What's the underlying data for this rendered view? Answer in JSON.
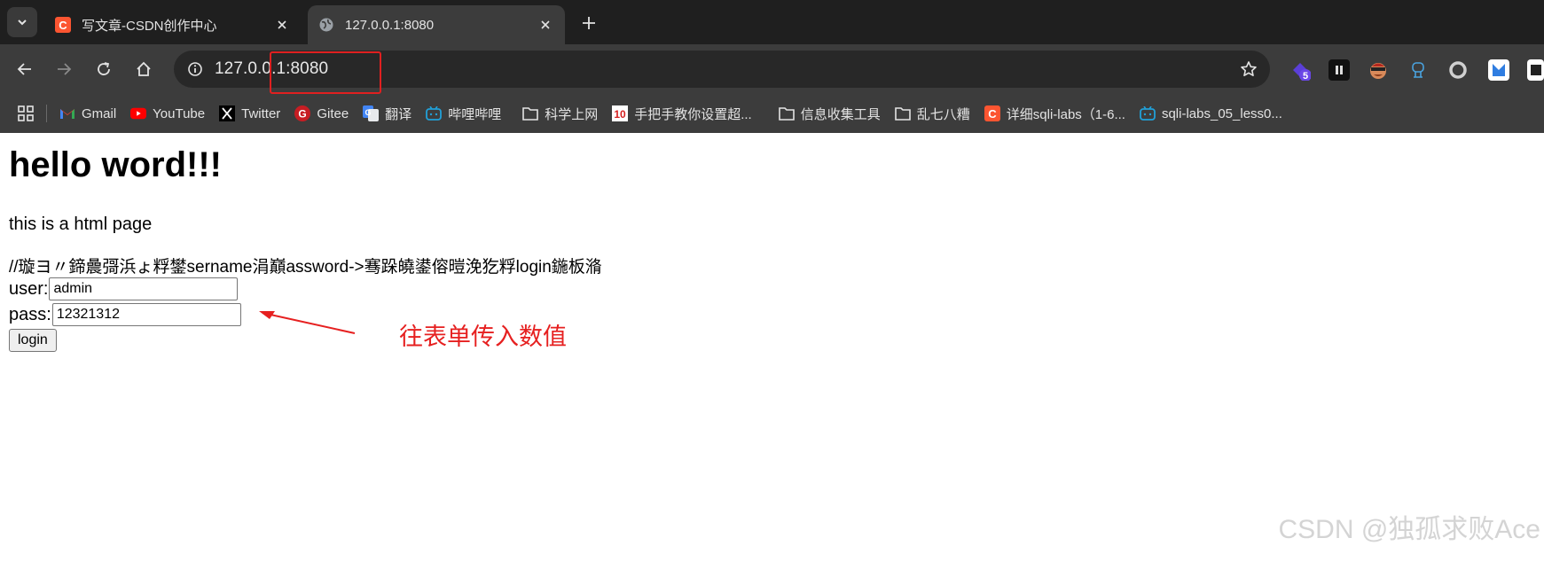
{
  "tabs": [
    {
      "title": "写文章-CSDN创作中心",
      "favicon": "csdn-icon",
      "active": false
    },
    {
      "title": "127.0.0.1:8080",
      "favicon": "globe-icon",
      "active": true
    }
  ],
  "address": {
    "host": "127.0.0.1",
    "port": ":8080"
  },
  "extensions": {
    "badge_count": "5"
  },
  "bookmarks": [
    {
      "label": "Gmail",
      "icon": "gmail-icon"
    },
    {
      "label": "YouTube",
      "icon": "youtube-icon"
    },
    {
      "label": "Twitter",
      "icon": "x-icon"
    },
    {
      "label": "Gitee",
      "icon": "gitee-icon"
    },
    {
      "label": "翻译",
      "icon": "translate-icon"
    },
    {
      "label": "哔哩哔哩",
      "icon": "bilibili-icon"
    },
    {
      "label": "科学上网",
      "icon": "folder-icon"
    },
    {
      "label": "手把手教你设置超...",
      "icon": "page-icon"
    },
    {
      "label": "信息收集工具",
      "icon": "folder-icon"
    },
    {
      "label": "乱七八糟",
      "icon": "folder-icon"
    },
    {
      "label": "详细sqli-labs（1-6...",
      "icon": "csdn-icon"
    },
    {
      "label": "sqli-labs_05_less0...",
      "icon": "bilibili-icon"
    }
  ],
  "page": {
    "heading": "hello word!!!",
    "paragraph": "this is a html page",
    "comment": "//璇ヨ〃鍗曟彁浜ょ粰鐢sername涓巔assword->骞跺皢鍙傛暟浼犵粰login鍦板潃",
    "user_label": "user:",
    "user_value": "admin",
    "pass_label": "pass:",
    "pass_value": "12321312",
    "login_label": "login"
  },
  "annotation": "往表单传入数值",
  "watermark": "CSDN @独孤求败Ace",
  "colors": {
    "annotation": "#e62020",
    "tabstrip": "#1f1f1f",
    "toolbar": "#3c3c3c"
  }
}
